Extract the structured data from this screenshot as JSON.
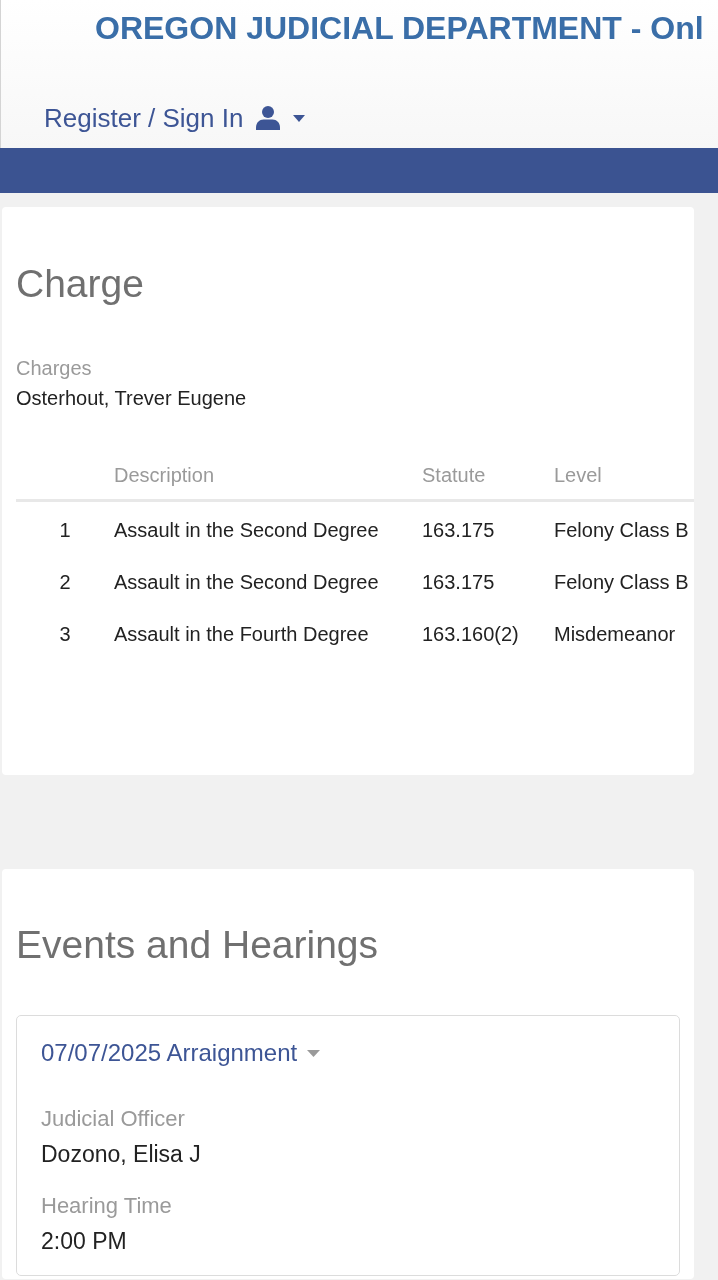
{
  "header": {
    "title": "OREGON JUDICIAL DEPARTMENT - Onl",
    "sign_in": "Register / Sign In"
  },
  "charge": {
    "heading": "Charge",
    "charges_label": "Charges",
    "party": "Osterhout, Trever Eugene",
    "table": {
      "columns": [
        "",
        "Description",
        "Statute",
        "Level"
      ],
      "rows": [
        [
          "1",
          "Assault in the Second Degree",
          "163.175",
          "Felony Class B"
        ],
        [
          "2",
          "Assault in the Second Degree",
          "163.175",
          "Felony Class B"
        ],
        [
          "3",
          "Assault in the Fourth Degree",
          "163.160(2)",
          "Misdemeanor"
        ]
      ]
    }
  },
  "events": {
    "heading": "Events and Hearings",
    "items": [
      {
        "title": "07/07/2025 Arraignment",
        "expanded": true,
        "fields": [
          {
            "label": "Judicial Officer",
            "value": "Dozono, Elisa J"
          },
          {
            "label": "Hearing Time",
            "value": "2:00 PM"
          }
        ]
      }
    ]
  }
}
